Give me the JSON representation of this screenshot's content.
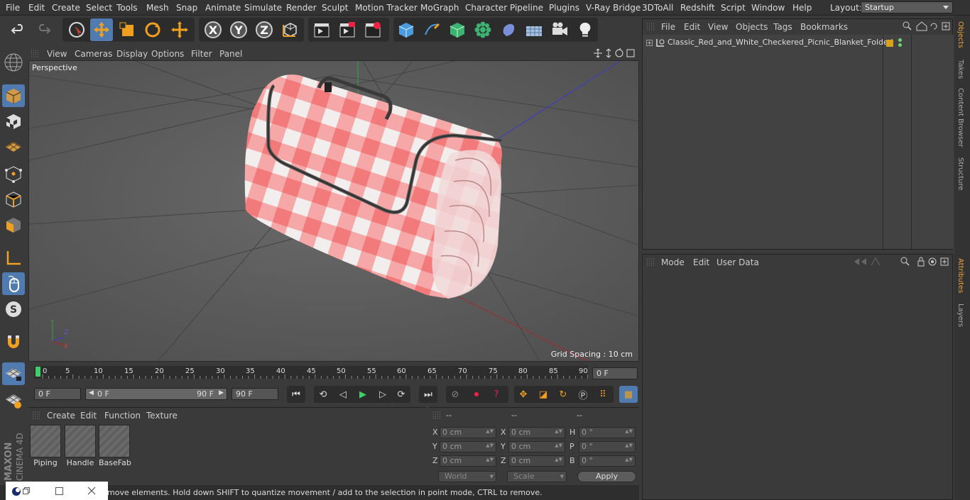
{
  "menu": {
    "items": [
      "File",
      "Edit",
      "Create",
      "Select",
      "Tools",
      "Mesh",
      "Snap",
      "Animate",
      "Simulate",
      "Render",
      "Sculpt",
      "Motion Tracker",
      "MoGraph",
      "Character",
      "Pipeline",
      "Plugins",
      "V-Ray Bridge",
      "3DToAll",
      "Redshift",
      "Script",
      "Window",
      "Help"
    ],
    "layout_label": "Layout:",
    "layout_value": "Startup"
  },
  "toolbar": {
    "axis_x": "X",
    "axis_y": "Y",
    "axis_z": "Z"
  },
  "viewport": {
    "menu": [
      "View",
      "Cameras",
      "Display",
      "Options",
      "Filter",
      "Panel"
    ],
    "label": "Perspective",
    "grid_spacing": "Grid Spacing : 10 cm",
    "background": "#5e5e5e"
  },
  "timeline": {
    "ticks": [
      "0",
      "5",
      "10",
      "15",
      "20",
      "25",
      "30",
      "35",
      "40",
      "45",
      "50",
      "55",
      "60",
      "65",
      "70",
      "75",
      "80",
      "85",
      "90"
    ],
    "current_frame": "0 F"
  },
  "playback": {
    "start_frame": "0 F",
    "range_start": "0 F",
    "range_end": "90 F",
    "end_frame": "90 F"
  },
  "materials": {
    "menu": [
      "Create",
      "Edit",
      "Function",
      "Texture"
    ],
    "items": [
      "Piping",
      "Handle",
      "BaseFab"
    ]
  },
  "coordinates": {
    "headers": [
      "--",
      "--",
      "--"
    ],
    "rows": [
      {
        "l1": "X",
        "v1": "0 cm",
        "l2": "X",
        "v2": "0 cm",
        "l3": "H",
        "v3": "0 °"
      },
      {
        "l1": "Y",
        "v1": "0 cm",
        "l2": "Y",
        "v2": "0 cm",
        "l3": "P",
        "v3": "0 °"
      },
      {
        "l1": "Z",
        "v1": "0 cm",
        "l2": "Z",
        "v2": "0 cm",
        "l3": "B",
        "v3": "0 °"
      }
    ],
    "mode_world": "World",
    "mode_scale": "Scale",
    "apply": "Apply"
  },
  "status": "move elements. Hold down SHIFT to quantize movement / add to the selection in point mode, CTRL to remove.",
  "object_manager": {
    "menu": [
      "File",
      "Edit",
      "View",
      "Objects",
      "Tags",
      "Bookmarks"
    ],
    "object_name": "Classic_Red_and_White_Checkered_Picnic_Blanket_Folded"
  },
  "attribute_manager": {
    "menu": [
      "Mode",
      "Edit",
      "User Data"
    ]
  },
  "side_tabs": [
    "Objects",
    "Takes",
    "Content Browser",
    "Structure",
    "Attributes",
    "Layers"
  ],
  "brand": {
    "maxon": "MAXON",
    "product": "CINEMA 4D"
  },
  "colors": {
    "accent": "#4f7bb0",
    "tab_active": "#e8a13b",
    "tag": "#d8a21f"
  }
}
